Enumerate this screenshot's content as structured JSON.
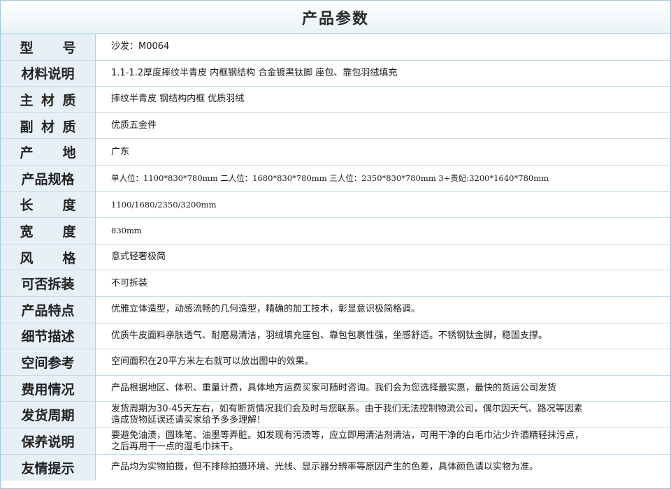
{
  "title": "产品参数",
  "rows": [
    {
      "label": "型号",
      "value": "沙发：M0064"
    },
    {
      "label": "材料说明",
      "value": "1.1-1.2厚度摔纹半青皮 内框钢结构 合金镀黑钛脚  座包、靠包羽绒填充"
    },
    {
      "label": "主材质",
      "value": "摔纹半青皮  钢结构内框  优质羽绒"
    },
    {
      "label": "副材质",
      "value": "优质五金件"
    },
    {
      "label": "产地",
      "value": "广东"
    },
    {
      "label": "产品规格",
      "value": "单人位：1100*830*780mm   二人位：1680*830*780mm  三人位：2350*830*780mm  3+贵妃:3200*1640*780mm"
    },
    {
      "label": "长度",
      "value": "1100/1680/2350/3200mm"
    },
    {
      "label": "宽度",
      "value": "830mm"
    },
    {
      "label": "风格",
      "value": "意式轻奢极简"
    },
    {
      "label": "可否拆装",
      "value": "不可拆装"
    },
    {
      "label": "产品特点",
      "value": "优雅立体造型，动感流畅的几何造型，精确的加工技术，彰显意识极简格调。"
    },
    {
      "label": "细节描述",
      "value": "优质牛皮面料亲肤透气、耐磨易清洁，羽绒填充座包、靠包包裹性强，坐感舒适。不锈钢钛金脚，稳固支撑。"
    },
    {
      "label": "空间参考",
      "value": "空间面积在20平方米左右就可以放出图中的效果。"
    },
    {
      "label": "费用情况",
      "value": "产品根据地区、体积、重量计费，具体地方运费买家可随时咨询。我们会为您选择最实惠，最快的货运公司发货"
    },
    {
      "label": "发货周期",
      "value_lines": [
        "发货周期为30-45天左右，如有断货情况我们会及时与您联系。由于我们无法控制物流公司，偶尔因天气、路况等因素",
        "造成货物延误还请买家给予多多理解！"
      ]
    },
    {
      "label": "保养说明",
      "value_lines": [
        "要避免油渍，圆珠笔、油墨等弄脏。如发现有污渍等，应立即用清洁剂清洁，可用干净的白毛巾沾少许酒精轻抹污点，",
        "之后再用干一点的湿毛巾抹干。"
      ]
    },
    {
      "label": "友情提示",
      "value": "产品均为实物拍摄，但不排除拍摄环境、光线、显示器分辨率等原因产生的色差，具体颜色请以实物为准。"
    }
  ]
}
